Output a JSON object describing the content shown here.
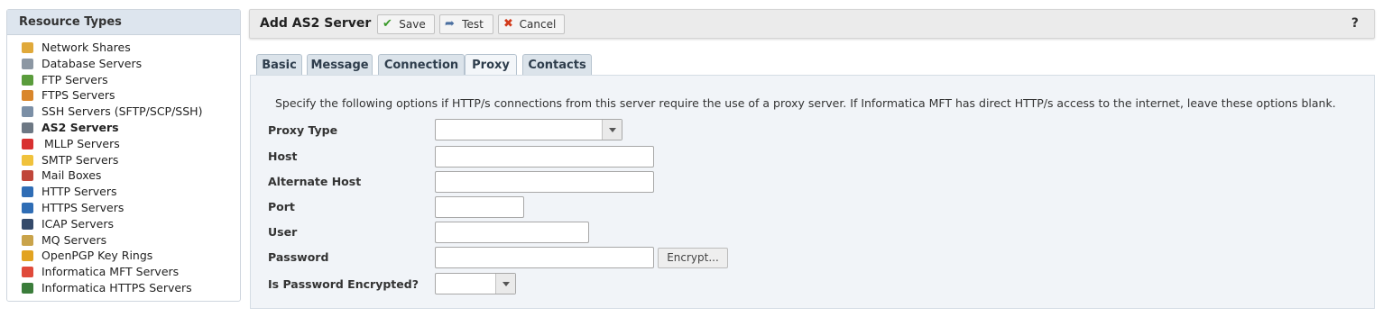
{
  "sidebar": {
    "title": "Resource Types",
    "items": [
      {
        "label": "Network Shares",
        "icon": "folder-icon",
        "color": "#e0a93a"
      },
      {
        "label": "Database Servers",
        "icon": "database-icon",
        "color": "#8c97a3"
      },
      {
        "label": "FTP Servers",
        "icon": "ftp-server-icon",
        "color": "#5a9c3c"
      },
      {
        "label": "FTPS Servers",
        "icon": "ftps-server-icon",
        "color": "#d9862b"
      },
      {
        "label": "SSH Servers (SFTP/SCP/SSH)",
        "icon": "ssh-server-icon",
        "color": "#7b8fa6"
      },
      {
        "label": "AS2 Servers",
        "icon": "as2-server-icon",
        "color": "#6d7884"
      },
      {
        "label": "MLLP Servers",
        "icon": "mllp-server-icon",
        "color": "#d83030"
      },
      {
        "label": "SMTP Servers",
        "icon": "envelope-icon",
        "color": "#f0c23c"
      },
      {
        "label": "Mail Boxes",
        "icon": "mailbox-icon",
        "color": "#c0463a"
      },
      {
        "label": "HTTP Servers",
        "icon": "http-monitor-icon",
        "color": "#2f6db5"
      },
      {
        "label": "HTTPS Servers",
        "icon": "https-monitor-icon",
        "color": "#2f6db5"
      },
      {
        "label": "ICAP Servers",
        "icon": "shield-icon",
        "color": "#344a6a"
      },
      {
        "label": "MQ Servers",
        "icon": "mq-server-icon",
        "color": "#c9a34a"
      },
      {
        "label": "OpenPGP Key Rings",
        "icon": "lock-icon",
        "color": "#e2a321"
      },
      {
        "label": "Informatica MFT Servers",
        "icon": "dots-icon",
        "color": "#e04a3a"
      },
      {
        "label": "Informatica HTTPS Servers",
        "icon": "monitor-icon",
        "color": "#3b7d3b"
      }
    ],
    "active_index": 5
  },
  "toolbar": {
    "title": "Add AS2 Server",
    "save_label": "Save",
    "test_label": "Test",
    "cancel_label": "Cancel",
    "help_label": "?",
    "save_icon_color": "#3a9a2a",
    "cancel_icon_color": "#d23a1a"
  },
  "tabs": [
    {
      "label": "Basic",
      "active": false
    },
    {
      "label": "Message",
      "active": false
    },
    {
      "label": "Connection",
      "active": false
    },
    {
      "label": "Proxy",
      "active": true
    },
    {
      "label": "Contacts",
      "active": false
    }
  ],
  "form": {
    "description": "Specify the following options if HTTP/s connections from this server require the use of a proxy server. If Informatica MFT has direct HTTP/s access to the internet, leave these options blank.",
    "proxy_type": {
      "label": "Proxy Type",
      "value": ""
    },
    "host": {
      "label": "Host",
      "value": ""
    },
    "alternate_host": {
      "label": "Alternate Host",
      "value": ""
    },
    "port": {
      "label": "Port",
      "value": ""
    },
    "user": {
      "label": "User",
      "value": ""
    },
    "password": {
      "label": "Password",
      "value": ""
    },
    "encrypt_label": "Encrypt...",
    "is_password_encrypted": {
      "label": "Is Password Encrypted?",
      "value": ""
    }
  }
}
